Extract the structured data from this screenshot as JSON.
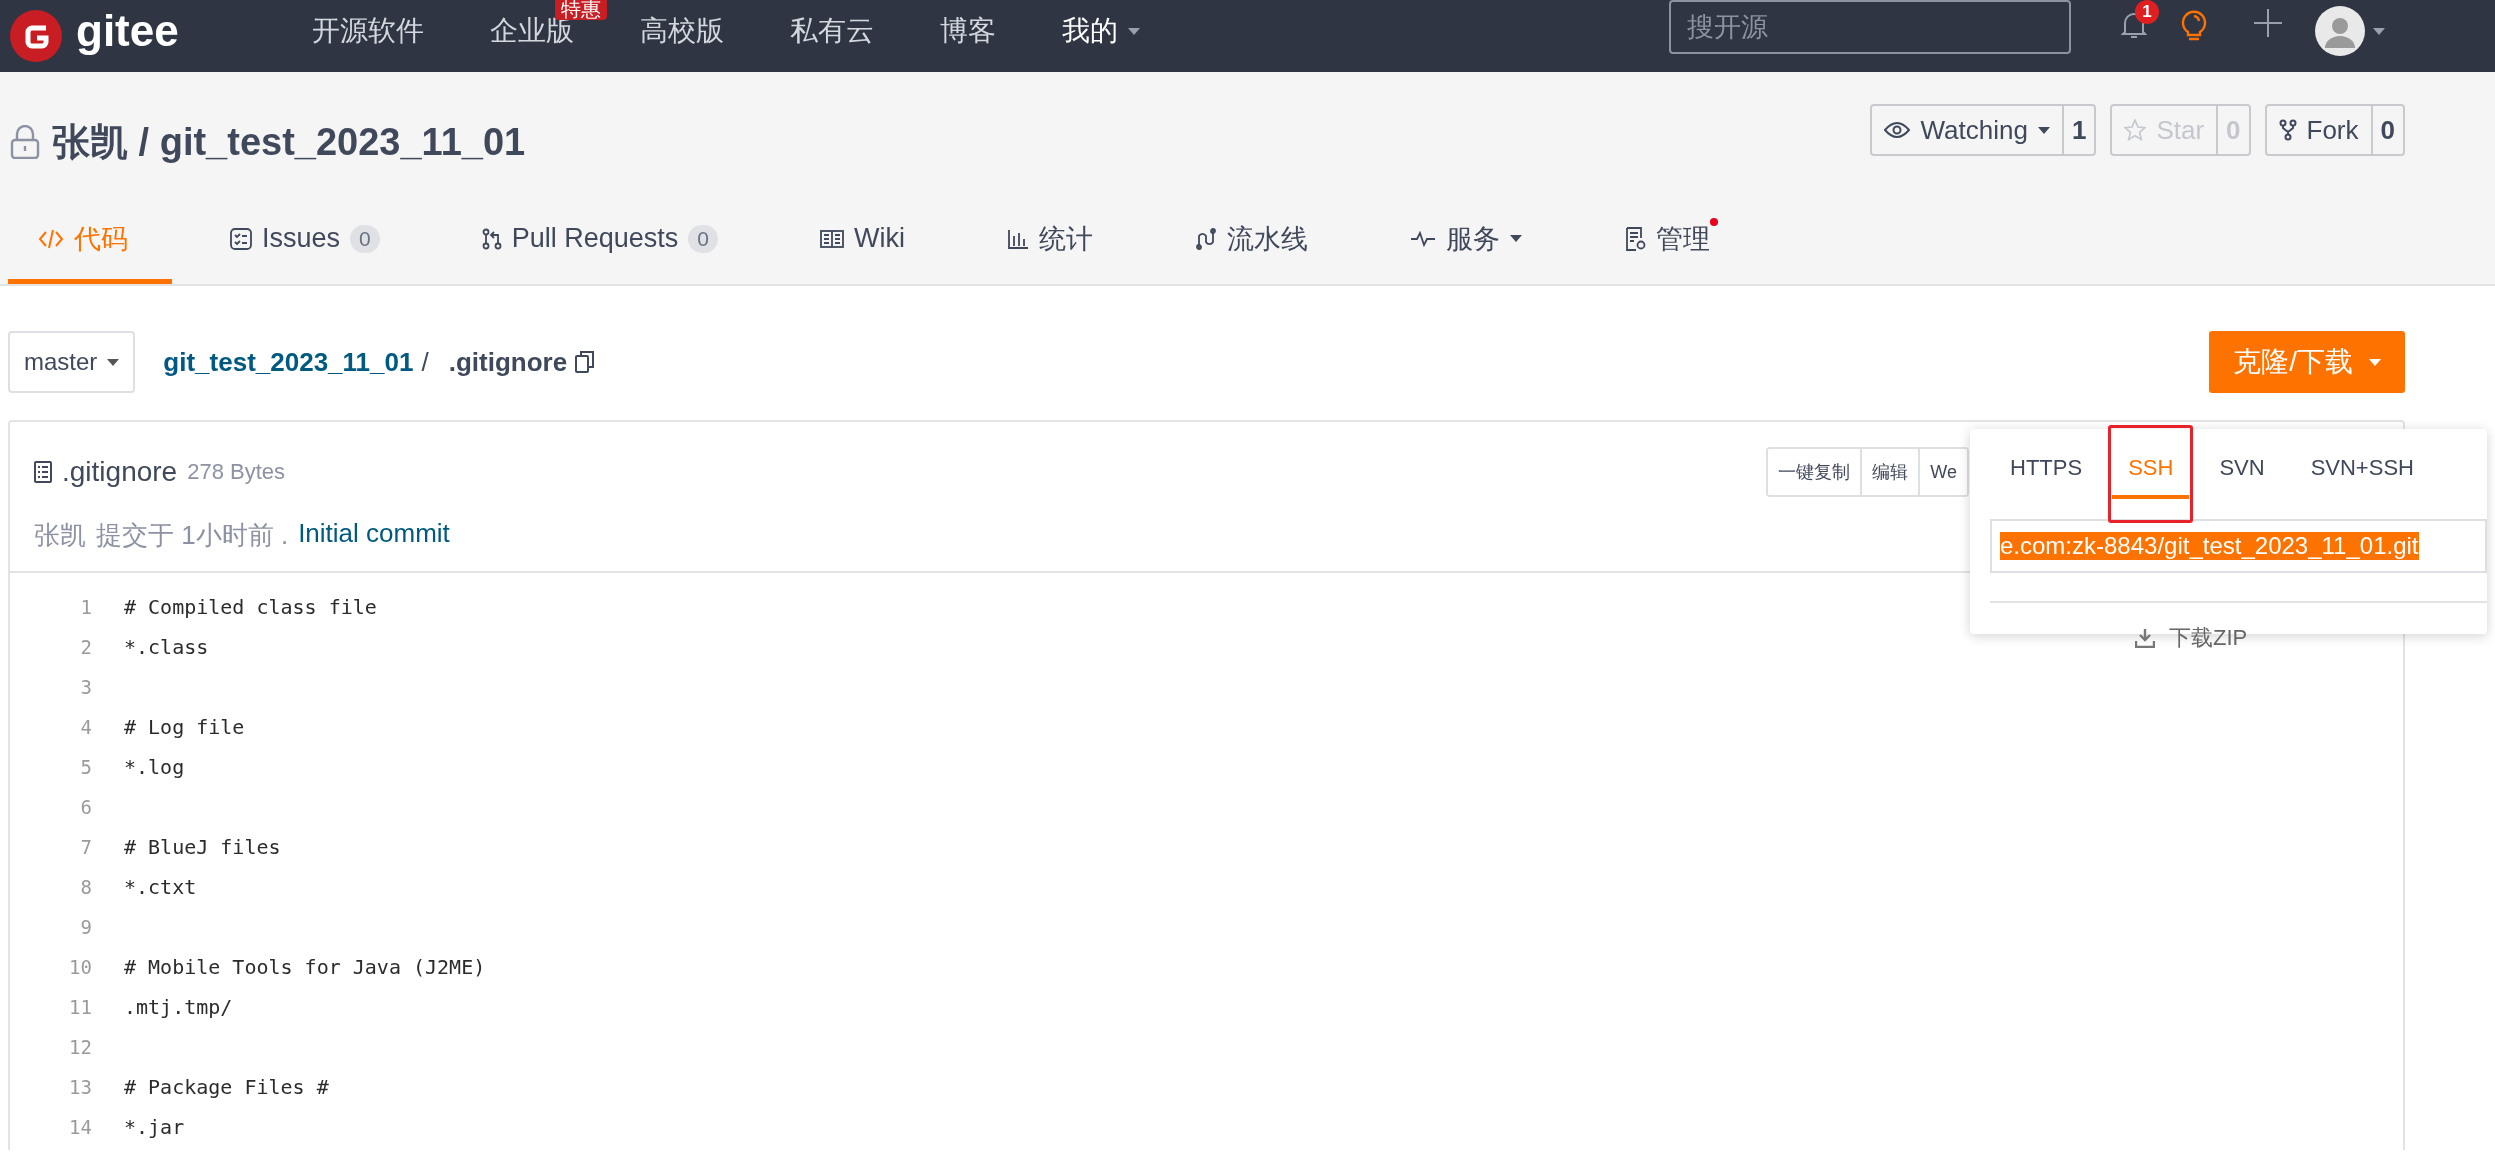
{
  "topbar": {
    "logo": "gitee",
    "nav": [
      {
        "label": "开源软件"
      },
      {
        "label": "企业版",
        "badge": "特惠"
      },
      {
        "label": "高校版"
      },
      {
        "label": "私有云"
      },
      {
        "label": "博客"
      },
      {
        "label": "我的",
        "dropdown": true
      }
    ],
    "search": {
      "placeholder": "搜开源"
    },
    "notification_count": "1"
  },
  "repo": {
    "private": true,
    "title": "张凯 / git_test_2023_11_01",
    "actions": [
      {
        "kind": "watch",
        "label": "Watching",
        "count": "1",
        "dropdown": true,
        "disabled": false
      },
      {
        "kind": "star",
        "label": "Star",
        "count": "0",
        "dropdown": false,
        "disabled": true
      },
      {
        "kind": "fork",
        "label": "Fork",
        "count": "0",
        "dropdown": false,
        "disabled": false
      }
    ]
  },
  "tabs": [
    {
      "label": "代码",
      "selected": true
    },
    {
      "label": "Issues",
      "count": "0",
      "selected": false
    },
    {
      "label": "Pull Requests",
      "count": "0",
      "selected": false
    },
    {
      "label": "Wiki",
      "selected": false
    },
    {
      "label": "统计",
      "selected": false
    },
    {
      "label": "流水线",
      "selected": false
    },
    {
      "label": "服务",
      "dropdown": true,
      "selected": false
    },
    {
      "label": "管理",
      "dot": true,
      "selected": false
    }
  ],
  "breadcrumb": {
    "branch": "master",
    "repo": "git_test_2023_11_01",
    "separator": "/",
    "file": ".gitignore"
  },
  "clone_button": "克隆/下载",
  "file": {
    "name": ".gitignore",
    "size": "278 Bytes",
    "actions": [
      "一键复制",
      "编辑",
      "We"
    ],
    "commit": {
      "author": "张凯",
      "text": "提交于 1小时前 .",
      "message": "Initial commit"
    },
    "lines": [
      {
        "number": "1",
        "text": "# Compiled class file"
      },
      {
        "number": "2",
        "text": "*.class"
      },
      {
        "number": "3"
      },
      {
        "number": "4",
        "text": "# Log file"
      },
      {
        "number": "5",
        "text": "*.log"
      },
      {
        "number": "6"
      },
      {
        "number": "7",
        "text": "# BlueJ files"
      },
      {
        "number": "8",
        "text": "*.ctxt"
      },
      {
        "number": "9"
      },
      {
        "number": "10",
        "text": "# Mobile Tools for Java (J2ME)"
      },
      {
        "number": "11",
        "text": ".mtj.tmp/"
      },
      {
        "number": "12"
      },
      {
        "number": "13",
        "text": "# Package Files #"
      },
      {
        "number": "14",
        "text": "*.jar"
      }
    ]
  },
  "clone_menu": {
    "tabs": [
      {
        "label": "HTTPS",
        "selected": false,
        "highlighted": false
      },
      {
        "label": "SSH",
        "selected": true,
        "highlighted": true
      },
      {
        "label": "SVN",
        "selected": false,
        "highlighted": false
      },
      {
        "label": "SVN+SSH",
        "selected": false,
        "highlighted": false
      }
    ],
    "url": "e.com:zk-8843/git_test_2023_11_01.git",
    "url_selected": true,
    "download": "下载ZIP"
  }
}
